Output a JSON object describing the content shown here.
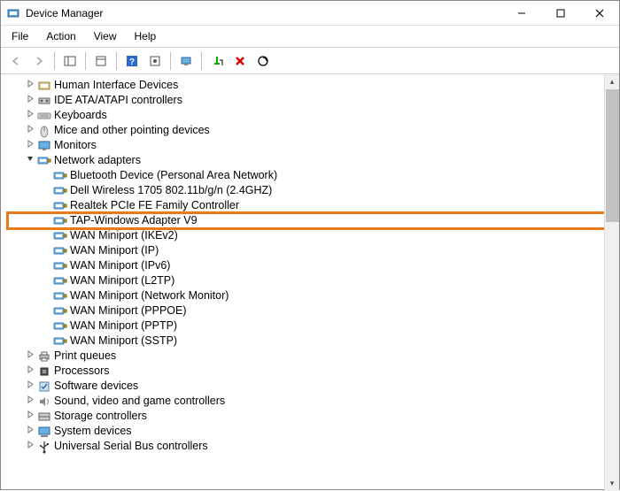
{
  "window": {
    "title": "Device Manager"
  },
  "menu": {
    "file": "File",
    "action": "Action",
    "view": "View",
    "help": "Help"
  },
  "tree": {
    "items": [
      {
        "label": "Human Interface Devices",
        "indent": 1,
        "icon": "hid",
        "expander": "closed"
      },
      {
        "label": "IDE ATA/ATAPI controllers",
        "indent": 1,
        "icon": "ide",
        "expander": "closed"
      },
      {
        "label": "Keyboards",
        "indent": 1,
        "icon": "keyboard",
        "expander": "closed"
      },
      {
        "label": "Mice and other pointing devices",
        "indent": 1,
        "icon": "mouse",
        "expander": "closed"
      },
      {
        "label": "Monitors",
        "indent": 1,
        "icon": "monitor",
        "expander": "closed"
      },
      {
        "label": "Network adapters",
        "indent": 1,
        "icon": "net",
        "expander": "open"
      },
      {
        "label": "Bluetooth Device (Personal Area Network)",
        "indent": 2,
        "icon": "net",
        "expander": "none"
      },
      {
        "label": "Dell Wireless 1705 802.11b/g/n (2.4GHZ)",
        "indent": 2,
        "icon": "net",
        "expander": "none"
      },
      {
        "label": "Realtek PCIe FE Family Controller",
        "indent": 2,
        "icon": "net",
        "expander": "none"
      },
      {
        "label": "TAP-Windows Adapter V9",
        "indent": 2,
        "icon": "net",
        "expander": "none",
        "highlight": true
      },
      {
        "label": "WAN Miniport (IKEv2)",
        "indent": 2,
        "icon": "net",
        "expander": "none"
      },
      {
        "label": "WAN Miniport (IP)",
        "indent": 2,
        "icon": "net",
        "expander": "none"
      },
      {
        "label": "WAN Miniport (IPv6)",
        "indent": 2,
        "icon": "net",
        "expander": "none"
      },
      {
        "label": "WAN Miniport (L2TP)",
        "indent": 2,
        "icon": "net",
        "expander": "none"
      },
      {
        "label": "WAN Miniport (Network Monitor)",
        "indent": 2,
        "icon": "net",
        "expander": "none"
      },
      {
        "label": "WAN Miniport (PPPOE)",
        "indent": 2,
        "icon": "net",
        "expander": "none"
      },
      {
        "label": "WAN Miniport (PPTP)",
        "indent": 2,
        "icon": "net",
        "expander": "none"
      },
      {
        "label": "WAN Miniport (SSTP)",
        "indent": 2,
        "icon": "net",
        "expander": "none"
      },
      {
        "label": "Print queues",
        "indent": 1,
        "icon": "print",
        "expander": "closed"
      },
      {
        "label": "Processors",
        "indent": 1,
        "icon": "cpu",
        "expander": "closed"
      },
      {
        "label": "Software devices",
        "indent": 1,
        "icon": "soft",
        "expander": "closed"
      },
      {
        "label": "Sound, video and game controllers",
        "indent": 1,
        "icon": "sound",
        "expander": "closed"
      },
      {
        "label": "Storage controllers",
        "indent": 1,
        "icon": "storage",
        "expander": "closed"
      },
      {
        "label": "System devices",
        "indent": 1,
        "icon": "system",
        "expander": "closed"
      },
      {
        "label": "Universal Serial Bus controllers",
        "indent": 1,
        "icon": "usb",
        "expander": "closed"
      }
    ]
  }
}
